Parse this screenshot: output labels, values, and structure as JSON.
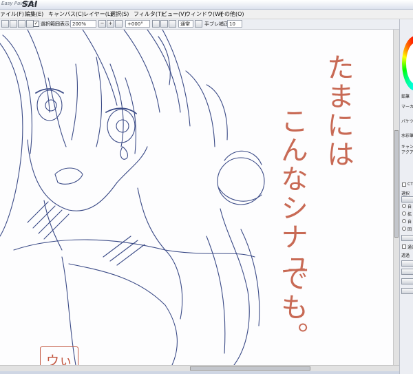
{
  "app": {
    "subtitle": "Easy PaintTool",
    "name": "SAI"
  },
  "menu": {
    "items": [
      "ファイル(F)",
      "編集(E)",
      "キャンバス(C)",
      "レイヤー(L)",
      "選択(S)",
      "フィルタ(T)",
      "ビュー(V)",
      "ウィンドウ(W)",
      "その他(O)"
    ]
  },
  "toolbar": {
    "show_selection_label": "選択範囲表示",
    "zoom": "200%",
    "rotation": "+000°",
    "blend_mode": "通常",
    "stabilizer_label": "手ブレ補正",
    "stabilizer_value": "10",
    "minus_glyph": "−",
    "plus_glyph": "+",
    "check_glyph": "✓"
  },
  "right_panel": {
    "labels": [
      "鉛筆",
      "マーカー",
      "バケツ",
      "水彩筆",
      "キャンバス",
      "アクア",
      "CT",
      "選択",
      "自",
      "拡",
      "自",
      "回",
      "通過",
      "透過"
    ],
    "radio_icon": "radio-icon",
    "checkbox_icon": "checkbox-icon"
  },
  "canvas": {
    "artwork": "line-art-sketch",
    "handwritten_text": [
      "たまには",
      "こんなシナュ",
      "でも。"
    ],
    "signature": "ウぃ",
    "line_color": "#3a4a86",
    "text_color": "#c86a55"
  },
  "colors": {
    "title_bg": "#dde3ee",
    "menu_bg": "#f0f0f0",
    "canvas_bg": "#fdfdfe",
    "status_bg": "#cfd6e4"
  }
}
